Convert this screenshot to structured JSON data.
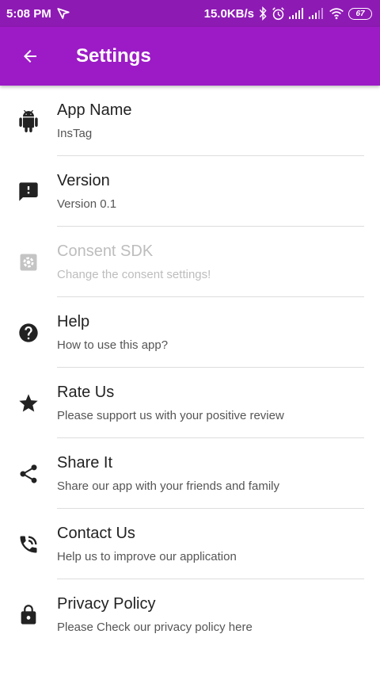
{
  "status_bar": {
    "time": "5:08 PM",
    "speed": "15.0KB/s",
    "battery": "67",
    "icons": [
      "navigation-icon",
      "bluetooth-icon",
      "alarm-icon",
      "signal-icon",
      "signal-icon",
      "wifi-icon",
      "battery-icon"
    ]
  },
  "app_bar": {
    "title": "Settings",
    "back_icon": "arrow-back-icon",
    "color": "#9c1bc6"
  },
  "settings": [
    {
      "title": "App Name",
      "subtitle": "InsTag",
      "icon": "android-icon",
      "enabled": true
    },
    {
      "title": "Version",
      "subtitle": "Version 0.1",
      "icon": "feedback-icon",
      "enabled": true
    },
    {
      "title": "Consent SDK",
      "subtitle": "Change the consent settings!",
      "icon": "settings-icon",
      "enabled": false
    },
    {
      "title": "Help",
      "subtitle": "How to use this app?",
      "icon": "help-icon",
      "enabled": true
    },
    {
      "title": "Rate Us",
      "subtitle": "Please support us with your positive review",
      "icon": "star-icon",
      "enabled": true
    },
    {
      "title": "Share It",
      "subtitle": "Share our app with your friends and family",
      "icon": "share-icon",
      "enabled": true
    },
    {
      "title": "Contact Us",
      "subtitle": "Help us to improve our application",
      "icon": "phone-icon",
      "enabled": true
    },
    {
      "title": "Privacy Policy",
      "subtitle": "Please Check our privacy policy here",
      "icon": "lock-icon",
      "enabled": true
    }
  ]
}
